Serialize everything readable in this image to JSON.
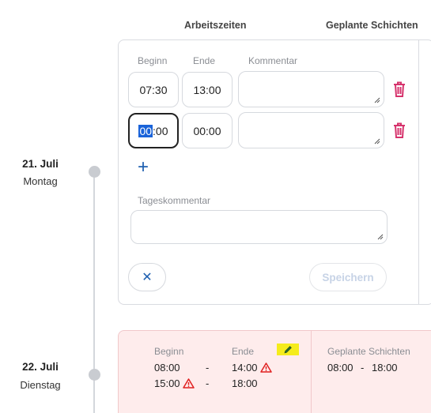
{
  "headers": {
    "work_times": "Arbeitszeiten",
    "planned_shifts": "Geplante Schichten"
  },
  "days": [
    {
      "date": "21. Juli",
      "weekday": "Montag"
    },
    {
      "date": "22. Juli",
      "weekday": "Dienstag"
    }
  ],
  "edit_form": {
    "label_begin": "Beginn",
    "label_end": "Ende",
    "label_comment": "Kommentar",
    "rows": [
      {
        "begin": "07:30",
        "end": "13:00",
        "comment": ""
      },
      {
        "begin_selected": "00",
        "begin_rest": ":00",
        "end": "00:00",
        "comment": ""
      }
    ],
    "add_label": "+",
    "day_comment_label": "Tageskommentar",
    "day_comment": "",
    "cancel_label": "✕",
    "save_label": "Speichern"
  },
  "day2": {
    "label_begin": "Beginn",
    "label_end": "Ende",
    "entries": [
      {
        "begin": "08:00",
        "dash": "-",
        "end": "14:00",
        "end_warning": true
      },
      {
        "begin": "15:00",
        "dash": "-",
        "end": "18:00",
        "begin_warning": true
      }
    ],
    "planned_label": "Geplante Schichten",
    "planned_begin": "08:00",
    "planned_dash": "-",
    "planned_end": "18:00"
  },
  "icons": {
    "trash": "trash-icon",
    "warning": "warning-icon",
    "edit": "pencil-icon",
    "close": "close-icon",
    "add": "plus-icon"
  },
  "colors": {
    "accent": "#1d5fb0",
    "delete": "#d6336c",
    "warning": "#e02020",
    "conflict_bg": "#feecec",
    "highlight": "#f5ec1c"
  }
}
